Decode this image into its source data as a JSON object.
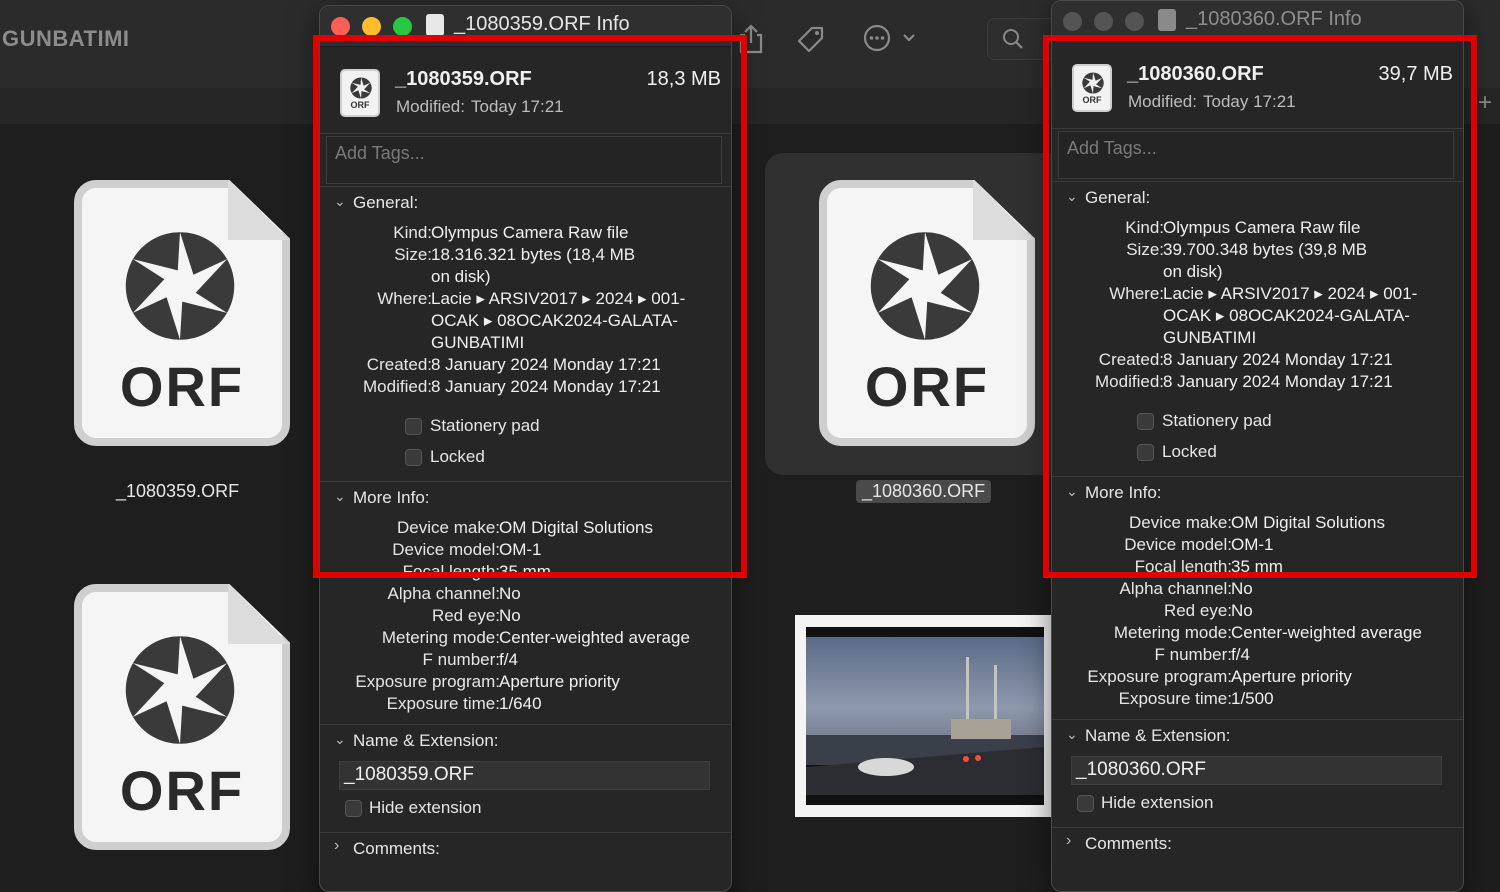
{
  "finder": {
    "folder_title": "GUNBATIMI",
    "icons": {
      "share": "share-icon",
      "tag": "tag-icon",
      "more": "ellipsis-circle-icon",
      "search": "search-icon",
      "add_tab": "plus-icon"
    },
    "plus": "+",
    "files": [
      {
        "name": "_1080359.ORF",
        "ext": "ORF",
        "selected": false
      },
      {
        "name": "_1080360.ORF",
        "ext": "ORF",
        "selected": true
      },
      {
        "name": "",
        "ext": "ORF",
        "selected": false
      }
    ]
  },
  "info_windows": [
    {
      "title": "_1080359.ORF Info",
      "active": true,
      "file_name": "_1080359.ORF",
      "file_size": "18,3 MB",
      "icon_ext": "ORF",
      "modified_label": "Modified:",
      "modified_value": "Today 17:21",
      "tags_placeholder": "Add Tags...",
      "general": {
        "header": "General:",
        "kind_label": "Kind:",
        "kind": "Olympus Camera Raw file",
        "size_label": "Size:",
        "size_line1": "18.316.321 bytes (18,4 MB",
        "size_line2": "on disk)",
        "where_label": "Where:",
        "where_line1": "Lacie ▸ ARSIV2017 ▸ 2024 ▸ 001-",
        "where_line2": "OCAK ▸ 08OCAK2024-GALATA-",
        "where_line3": "GUNBATIMI",
        "created_label": "Created:",
        "created": "8 January 2024 Monday 17:21",
        "modified_label": "Modified:",
        "modified": "8 January 2024 Monday 17:21",
        "stationery": "Stationery pad",
        "locked": "Locked"
      },
      "more_info": {
        "header": "More Info:",
        "rows": [
          {
            "k": "Device make:",
            "v": "OM Digital Solutions"
          },
          {
            "k": "Device model:",
            "v": "OM-1"
          },
          {
            "k": "Focal length:",
            "v": "35 mm"
          },
          {
            "k": "Alpha channel:",
            "v": "No"
          },
          {
            "k": "Red eye:",
            "v": "No"
          },
          {
            "k": "Metering mode:",
            "v": "Center-weighted average"
          },
          {
            "k": "F number:",
            "v": "f/4"
          },
          {
            "k": "Exposure program:",
            "v": "Aperture priority"
          },
          {
            "k": "Exposure time:",
            "v": "1/640"
          }
        ]
      },
      "name_ext": {
        "header": "Name & Extension:",
        "value": "_1080359.ORF",
        "hide_ext": "Hide extension"
      },
      "comments_header": "Comments:"
    },
    {
      "title": "_1080360.ORF Info",
      "active": false,
      "file_name": "_1080360.ORF",
      "file_size": "39,7 MB",
      "icon_ext": "ORF",
      "modified_label": "Modified:",
      "modified_value": "Today 17:21",
      "tags_placeholder": "Add Tags...",
      "general": {
        "header": "General:",
        "kind_label": "Kind:",
        "kind": "Olympus Camera Raw file",
        "size_label": "Size:",
        "size_line1": "39.700.348 bytes (39,8 MB",
        "size_line2": "on disk)",
        "where_label": "Where:",
        "where_line1": "Lacie ▸ ARSIV2017 ▸ 2024 ▸ 001-",
        "where_line2": "OCAK ▸ 08OCAK2024-GALATA-",
        "where_line3": "GUNBATIMI",
        "created_label": "Created:",
        "created": "8 January 2024 Monday 17:21",
        "modified_label": "Modified:",
        "modified": "8 January 2024 Monday 17:21",
        "stationery": "Stationery pad",
        "locked": "Locked"
      },
      "more_info": {
        "header": "More Info:",
        "rows": [
          {
            "k": "Device make:",
            "v": "OM Digital Solutions"
          },
          {
            "k": "Device model:",
            "v": "OM-1"
          },
          {
            "k": "Focal length:",
            "v": "35 mm"
          },
          {
            "k": "Alpha channel:",
            "v": "No"
          },
          {
            "k": "Red eye:",
            "v": "No"
          },
          {
            "k": "Metering mode:",
            "v": "Center-weighted average"
          },
          {
            "k": "F number:",
            "v": "f/4"
          },
          {
            "k": "Exposure program:",
            "v": "Aperture priority"
          },
          {
            "k": "Exposure time:",
            "v": "1/500"
          }
        ]
      },
      "name_ext": {
        "header": "Name & Extension:",
        "value": "_1080360.ORF",
        "hide_ext": "Hide extension"
      },
      "comments_header": "Comments:"
    }
  ],
  "annotation_color": "#e00000"
}
